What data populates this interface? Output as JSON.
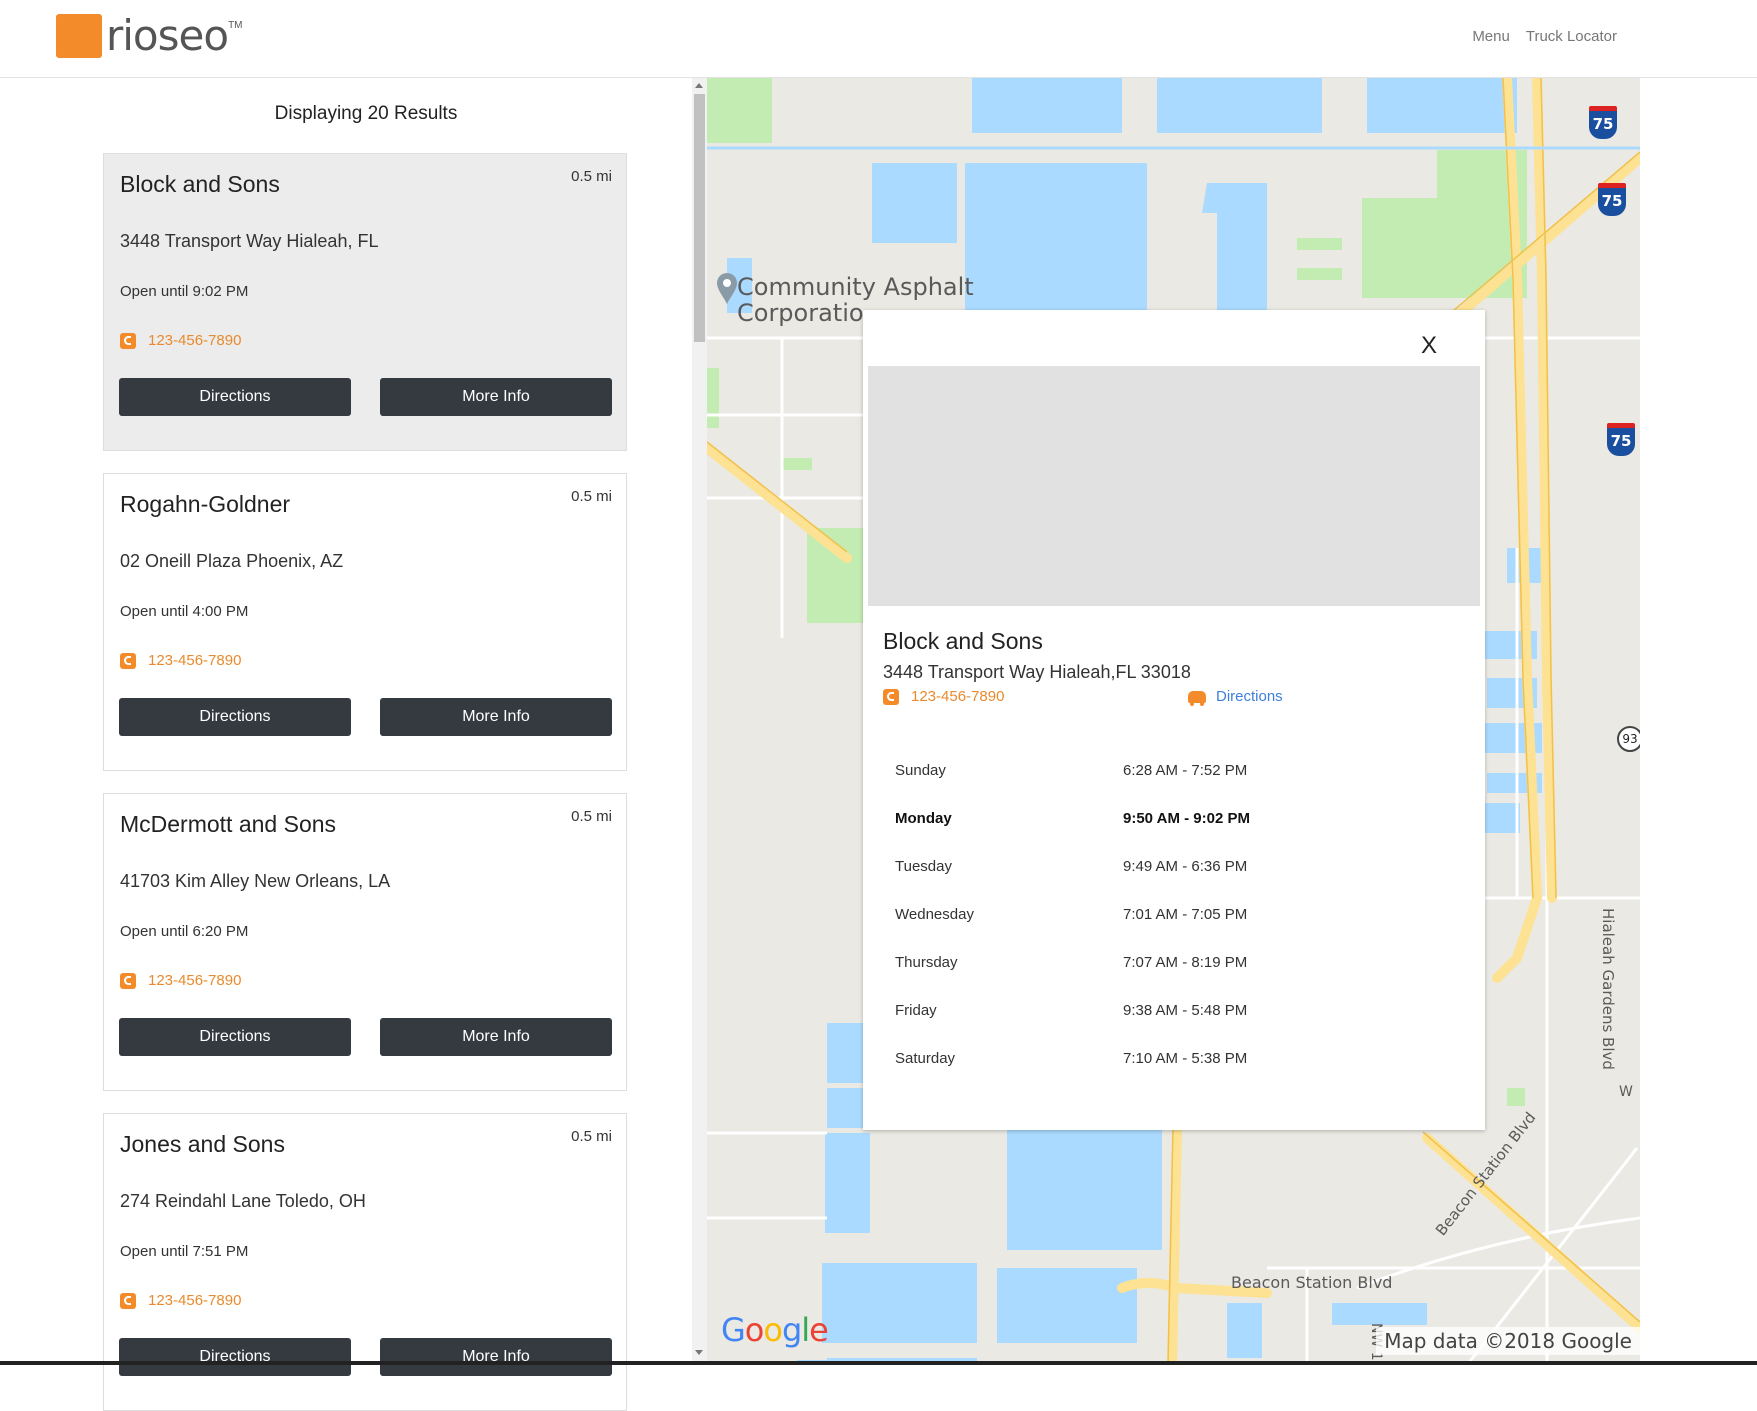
{
  "brand": {
    "logo_text_1": "rio",
    "logo_text_2": "seo",
    "tm": "TM"
  },
  "nav": {
    "menu": "Menu",
    "truck_locator": "Truck Locator"
  },
  "results": {
    "title": "Displaying 20 Results",
    "items": [
      {
        "name": "Block and Sons",
        "distance": "0.5 mi",
        "address": "3448 Transport Way Hialeah, FL",
        "hours": "Open until 9:02 PM",
        "phone": "123-456-7890",
        "directions": "Directions",
        "more_info": "More Info"
      },
      {
        "name": "Rogahn-Goldner",
        "distance": "0.5 mi",
        "address": "02 Oneill Plaza Phoenix, AZ",
        "hours": "Open until 4:00 PM",
        "phone": "123-456-7890",
        "directions": "Directions",
        "more_info": "More Info"
      },
      {
        "name": "McDermott and Sons",
        "distance": "0.5 mi",
        "address": "41703 Kim Alley New Orleans, LA",
        "hours": "Open until 6:20 PM",
        "phone": "123-456-7890",
        "directions": "Directions",
        "more_info": "More Info"
      },
      {
        "name": "Jones and Sons",
        "distance": "0.5 mi",
        "address": "274 Reindahl Lane Toledo, OH",
        "hours": "Open until 7:51 PM",
        "phone": "123-456-7890",
        "directions": "Directions",
        "more_info": "More Info"
      }
    ]
  },
  "map": {
    "poi_label_1": "Community Asphalt",
    "poi_label_2": "Corporatio",
    "road_1": "Beacon Station Blvd",
    "road_2": "Beacon Station Blvd",
    "road_3": "Hialeah Gardens Blvd",
    "road_4": "NW 1",
    "road_5": "W",
    "interstate": "75",
    "route_93": "93",
    "google": [
      "G",
      "o",
      "o",
      "g",
      "l",
      "e"
    ],
    "attribution": "Map data ©2018 Google",
    "colors": {
      "water": "#aadaff",
      "park": "#c3ecb2",
      "highway": "#fde293",
      "land": "#ebe9e3"
    }
  },
  "popup": {
    "close": "X",
    "name": "Block and Sons",
    "address": "3448 Transport Way Hialeah,FL 33018",
    "phone": "123-456-7890",
    "directions": "Directions",
    "hours": [
      {
        "day": "Sunday",
        "time": "6:28 AM - 7:52 PM"
      },
      {
        "day": "Monday",
        "time": "9:50 AM - 9:02 PM"
      },
      {
        "day": "Tuesday",
        "time": "9:49 AM - 6:36 PM"
      },
      {
        "day": "Wednesday",
        "time": "7:01 AM - 7:05 PM"
      },
      {
        "day": "Thursday",
        "time": "7:07 AM - 8:19 PM"
      },
      {
        "day": "Friday",
        "time": "9:38 AM - 5:48 PM"
      },
      {
        "day": "Saturday",
        "time": "7:10 AM - 5:38 PM"
      }
    ]
  },
  "colors": {
    "accent": "#f38b2b",
    "button": "#343a40",
    "link": "#3f7fdc"
  }
}
